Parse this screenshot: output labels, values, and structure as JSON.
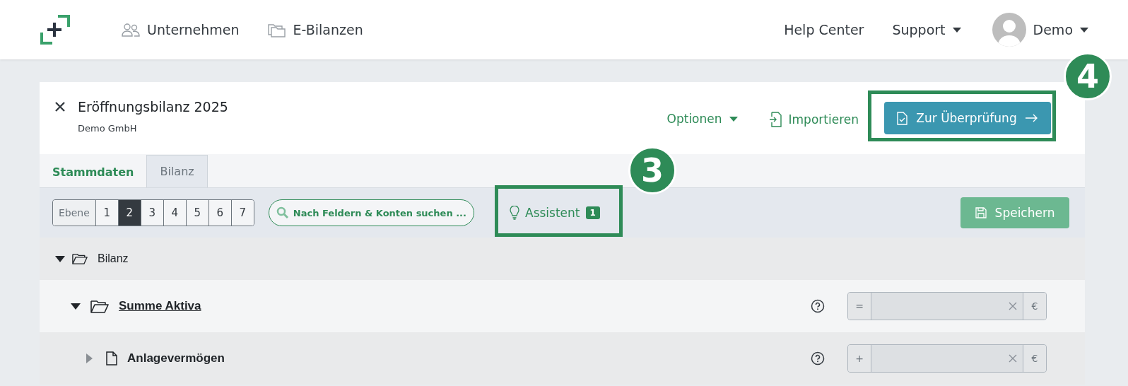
{
  "nav": {
    "items": [
      {
        "kind": "people",
        "label": "Unternehmen"
      },
      {
        "kind": "folders",
        "label": "E-Bilanzen"
      }
    ],
    "right": [
      {
        "kind": "link",
        "label": "Help Center"
      },
      {
        "kind": "dropdown",
        "label": "Support"
      }
    ],
    "user": {
      "name": "Demo"
    }
  },
  "document": {
    "title": "Eröffnungsbilanz 2025",
    "subtitle": "Demo GmbH",
    "actions": [
      {
        "kind": "dropdown",
        "label": "Optionen"
      },
      {
        "kind": "import",
        "label": "Importieren"
      }
    ],
    "primary": "Zur Überprüfung"
  },
  "tabs": [
    {
      "label": "Stammdaten",
      "selected": false
    },
    {
      "label": "Bilanz",
      "selected": true
    }
  ],
  "toolbar": {
    "level_label": "Ebene",
    "levels": [
      {
        "label": "1",
        "selected": false
      },
      {
        "label": "2",
        "selected": true
      },
      {
        "label": "3",
        "selected": false
      },
      {
        "label": "4",
        "selected": false
      },
      {
        "label": "5",
        "selected": false
      },
      {
        "label": "6",
        "selected": false
      },
      {
        "label": "7",
        "selected": false
      }
    ],
    "search": "Nach Feldern & Konten suchen ...",
    "assistant": {
      "label": "Assistent",
      "count": "1"
    },
    "save": "Speichern"
  },
  "tree": [
    {
      "kind": "root",
      "label": "Bilanz",
      "expanded": true,
      "children": [
        {
          "kind": "sum",
          "label": "Summe Aktiva",
          "expanded": true,
          "operator": "=",
          "currency": "€",
          "children": [
            {
              "kind": "position",
              "label": "Anlagevermögen",
              "expanded": false,
              "operator": "+",
              "currency": "€"
            }
          ]
        }
      ]
    }
  ],
  "callouts": [
    {
      "label": "3",
      "kind": "assistant"
    },
    {
      "label": "4",
      "kind": "primary"
    }
  ]
}
